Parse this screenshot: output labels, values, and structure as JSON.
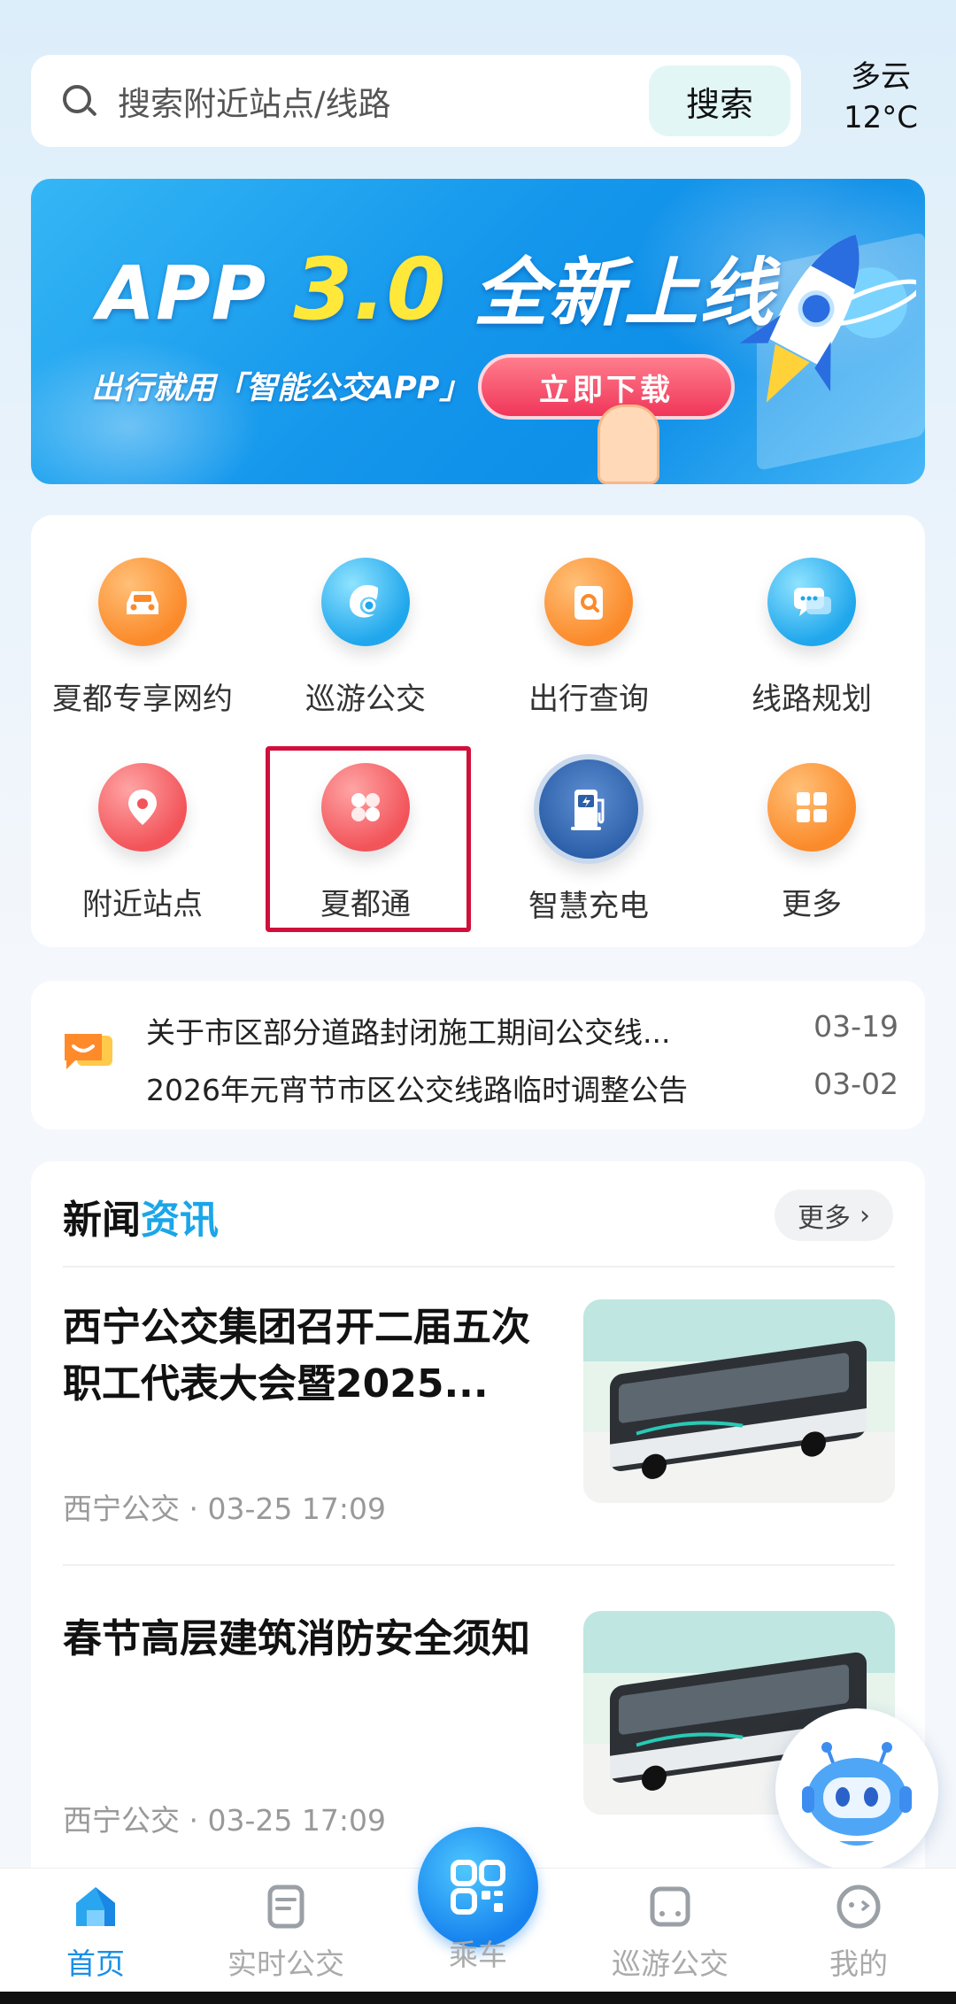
{
  "search": {
    "placeholder": "搜索附近站点/线路",
    "button_label": "搜索"
  },
  "weather": {
    "condition": "多云",
    "temperature": "12°C"
  },
  "banner": {
    "headline_prefix": "APP",
    "headline_version": "3.0",
    "headline_suffix": "全新上线",
    "subtitle": "出行就用「智能公交APP」",
    "cta_label": "立即下载"
  },
  "quick_grid": {
    "items": [
      {
        "label": "夏都专享网约",
        "icon": "car-icon",
        "color": "#fb8a2a"
      },
      {
        "label": "巡游公交",
        "icon": "swirl-logo-icon",
        "color": "#1fa6ec"
      },
      {
        "label": "出行查询",
        "icon": "document-search-icon",
        "color": "#fb8a2a"
      },
      {
        "label": "线路规划",
        "icon": "chat-bubbles-icon",
        "color": "#1fa6ec"
      },
      {
        "label": "附近站点",
        "icon": "location-pin-icon",
        "color": "#f2545a"
      },
      {
        "label": "夏都通",
        "icon": "four-petal-icon",
        "color": "#f2545a"
      },
      {
        "label": "智慧充电",
        "icon": "charging-station-icon",
        "color": "#2b5fa8"
      },
      {
        "label": "更多",
        "icon": "grid-icon",
        "color": "#fb8a2a"
      }
    ],
    "highlighted_item": "夏都通"
  },
  "notices": [
    {
      "title": "关于市区部分道路封闭施工期间公交线...",
      "date": "03-19"
    },
    {
      "title": "2026年元宵节市区公交线路临时调整公告",
      "date": "03-02"
    }
  ],
  "news": {
    "header_part1": "新闻",
    "header_part2": "资讯",
    "more_label": "更多",
    "items": [
      {
        "title": "西宁公交集团召开二届五次职工代表大会暨2025...",
        "source": "西宁公交",
        "time": "03-25 17:09"
      },
      {
        "title": "春节高层建筑消防安全须知",
        "source": "西宁公交",
        "time": "03-25 17:09"
      }
    ]
  },
  "tabbar": {
    "tabs": [
      {
        "label": "首页",
        "icon": "home-icon",
        "active": true
      },
      {
        "label": "实时公交",
        "icon": "document-icon",
        "active": false
      },
      {
        "label": "乘车",
        "icon": "qr-code-icon",
        "active": false
      },
      {
        "label": "巡游公交",
        "icon": "bus-front-icon",
        "active": false
      },
      {
        "label": "我的",
        "icon": "face-icon",
        "active": false
      }
    ]
  },
  "colors": {
    "accent": "#1aa6e8",
    "tab_active": "#1a8fe6",
    "highlight_border": "#d0103a"
  }
}
